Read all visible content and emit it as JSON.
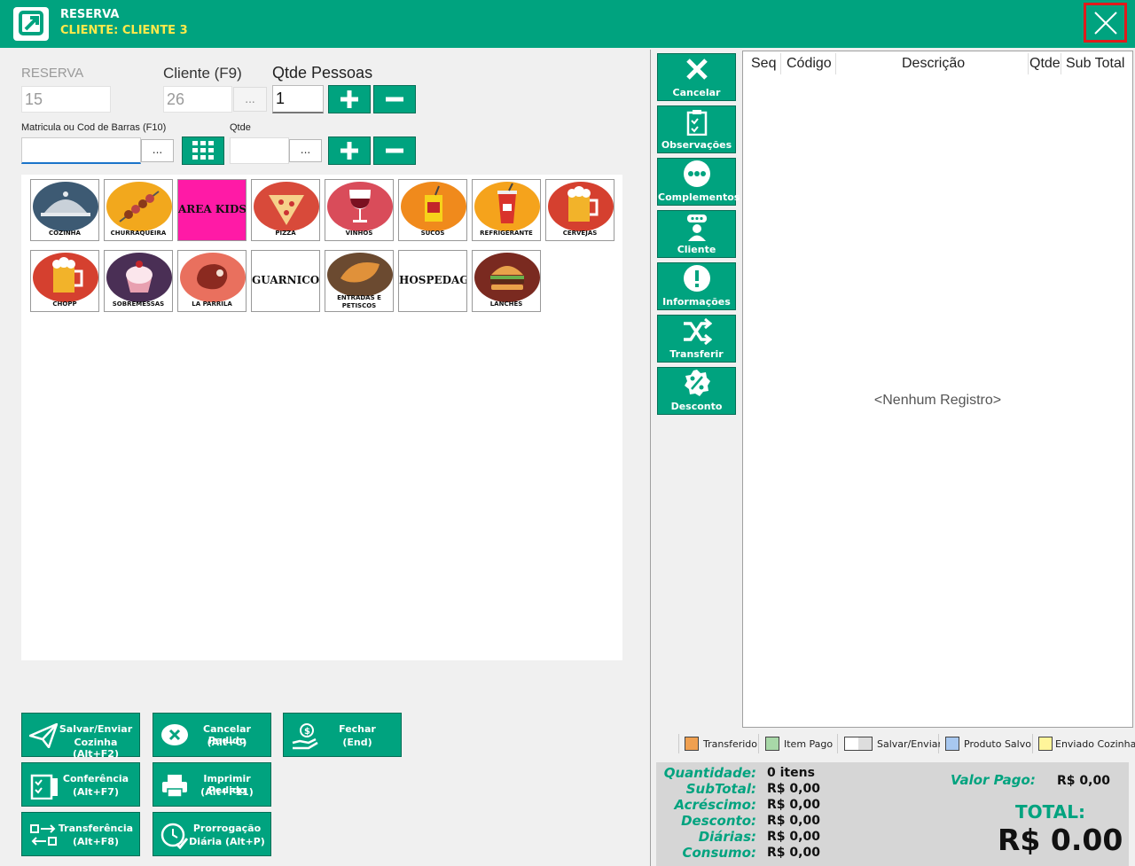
{
  "header": {
    "title": "RESERVA",
    "subtitle": "CLIENTE: CLIENTE 3"
  },
  "colors": {
    "brand": "#00a37f",
    "subtitle": "#ffe94a",
    "close_border": "#e01b1b",
    "kids_tile": "#ff1aa6"
  },
  "form": {
    "reserva_label": "RESERVA",
    "reserva_value": "15",
    "cliente_label": "Cliente (F9)",
    "cliente_value": "26",
    "cliente_btn": "...",
    "qtde_pessoas_label": "Qtde Pessoas",
    "qtde_pessoas_value": "1",
    "matricula_label": "Matricula ou Cod de Barras (F10)",
    "matricula_value": "",
    "matricula_btn": "...",
    "qtde_label": "Qtde",
    "qtde_value": "",
    "qtde_btn": "..."
  },
  "categories": [
    {
      "label": "COZINHA",
      "icon": "cloche-icon"
    },
    {
      "label": "CHURRAQUEIRA",
      "icon": "skewer-icon"
    },
    {
      "label": "AREA KIDS",
      "icon": "none"
    },
    {
      "label": "PIZZA",
      "icon": "pizza-icon"
    },
    {
      "label": "VINHOS",
      "icon": "wine-glass-icon"
    },
    {
      "label": "SUCOS",
      "icon": "juice-box-icon"
    },
    {
      "label": "REFRIGERANTE",
      "icon": "soda-cup-icon"
    },
    {
      "label": "CERVEJAS",
      "icon": "beer-mug-icon"
    },
    {
      "label": "CHOPP",
      "icon": "draft-beer-icon"
    },
    {
      "label": "SOBREMESSAS",
      "icon": "cupcake-icon"
    },
    {
      "label": "LA PARRILA",
      "icon": "steak-icon"
    },
    {
      "label": "GUARNICOES",
      "icon": "none"
    },
    {
      "label": "ENTRADAS E PETISCOS",
      "icon": "croissant-icon"
    },
    {
      "label": "HOSPEDAGEM",
      "icon": "none"
    },
    {
      "label": "LANCHES",
      "icon": "burger-icon"
    }
  ],
  "actions": [
    {
      "l1": "Salvar/Enviar",
      "l2": "Cozinha (Alt+F2)",
      "icon": "paper-plane-icon"
    },
    {
      "l1": "Cancelar Pedido",
      "l2": "(Alt+C)",
      "icon": "cancel-chat-icon"
    },
    {
      "l1": "Fechar",
      "l2": "(End)",
      "icon": "hand-money-icon"
    },
    {
      "l1": "Conferência",
      "l2": "(Alt+F7)",
      "icon": "checklist-icon"
    },
    {
      "l1": "Imprimir Pedido",
      "l2": "(Alt+F11)",
      "icon": "printer-icon"
    },
    {
      "l1": "Transferência",
      "l2": "(Alt+F8)",
      "icon": "transfer-arrows-icon"
    },
    {
      "l1": "Prorrogação",
      "l2": "Diária (Alt+P)",
      "icon": "clock-check-icon"
    }
  ],
  "side_buttons": [
    "Cancelar",
    "Observações",
    "Complementos",
    "Cliente",
    "Informações",
    "Transferir",
    "Desconto"
  ],
  "grid": {
    "columns": [
      "Seq",
      "Código",
      "Descrição",
      "Qtde",
      "Sub Total"
    ],
    "empty_text": "<Nenhum Registro>"
  },
  "legend": [
    {
      "label": "Transferido",
      "color": "#f0a050"
    },
    {
      "label": "Item Pago",
      "color": "#a8d8a8"
    },
    {
      "label": "Salvar/Enviar",
      "color": "#ffffff"
    },
    {
      "label": "Produto Salvo",
      "color": "#a8c8f0"
    },
    {
      "label": "Enviado Cozinha",
      "color": "#fff59a"
    }
  ],
  "totals": {
    "quantidade_label": "Quantidade:",
    "quantidade_value": "0 itens",
    "subtotal_label": "SubTotal:",
    "subtotal_value": "R$ 0,00",
    "acrescimo_label": "Acréscimo:",
    "acrescimo_value": "R$ 0,00",
    "desconto_label": "Desconto:",
    "desconto_value": "R$ 0,00",
    "diarias_label": "Diárias:",
    "diarias_value": "R$ 0,00",
    "consumo_label": "Consumo:",
    "consumo_value": "R$ 0,00",
    "valor_pago_label": "Valor Pago:",
    "valor_pago_value": "R$ 0,00",
    "total_label": "TOTAL:",
    "total_value": "R$ 0.00"
  }
}
